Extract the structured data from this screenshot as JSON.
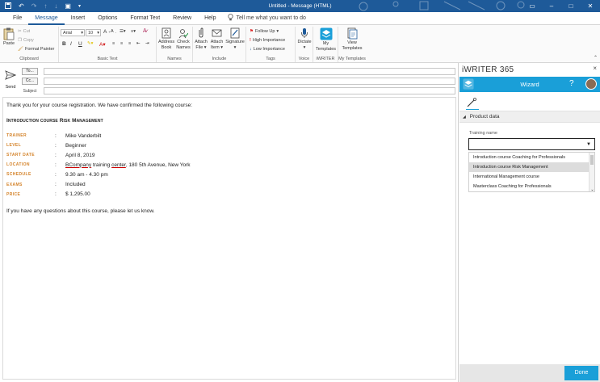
{
  "window": {
    "title": "Untitled - Message (HTML)"
  },
  "tabs": [
    "File",
    "Message",
    "Insert",
    "Options",
    "Format Text",
    "Review",
    "Help"
  ],
  "tell_me": "Tell me what you want to do",
  "ribbon": {
    "clipboard": {
      "label": "Clipboard",
      "paste": "Paste",
      "cut": "Cut",
      "copy": "Copy",
      "format_painter": "Format Painter"
    },
    "basic_text": {
      "label": "Basic Text",
      "font": "Arial",
      "size": "10",
      "bold": "B",
      "italic": "I",
      "underline": "U"
    },
    "names": {
      "label": "Names",
      "address_book": [
        "Address",
        "Book"
      ],
      "check_names": [
        "Check",
        "Names"
      ]
    },
    "include": {
      "label": "Include",
      "attach_file": [
        "Attach",
        "File"
      ],
      "attach_item": [
        "Attach",
        "Item"
      ],
      "signature": "Signature"
    },
    "tags": {
      "label": "Tags",
      "follow_up": "Follow Up",
      "high_importance": "High Importance",
      "low_importance": "Low Importance"
    },
    "voice": {
      "label": "Voice",
      "dictate": "Dictate"
    },
    "iwriter": {
      "label": "iWRITER",
      "my_templates": [
        "My",
        "Templates"
      ]
    },
    "my_templates_group": {
      "label": "My Templates",
      "view_templates": [
        "View",
        "Templates"
      ]
    }
  },
  "compose": {
    "send": "Send",
    "to": "To...",
    "cc": "Cc...",
    "subject": "Subject"
  },
  "email": {
    "intro": "Thank you for your course registration. We have confirmed the following course:",
    "course_title": "Introduction course Risk Management",
    "rows": [
      {
        "key": "TRAINER",
        "colon": ":",
        "value": "Mike Vanderbilt"
      },
      {
        "key": "LEVEL",
        "colon": ":",
        "value": "Beginner"
      },
      {
        "key": "START DATE",
        "colon": ":",
        "value": "April 8, 2019"
      },
      {
        "key": "LOCATION",
        "colon": ":",
        "value_a": "BCompany",
        "value_b": " training ",
        "value_c": "center",
        "value_d": ", 180 5th Avenue, New York"
      },
      {
        "key": "SCHEDULE",
        "colon": ":",
        "value": "9.30 am - 4.30 pm"
      },
      {
        "key": "EXAMS",
        "colon": ":",
        "value": "Included"
      },
      {
        "key": "PRICE",
        "colon": ":",
        "value": "$ 1,295.00"
      }
    ],
    "closing": "If you have any questions about this course, please let us know."
  },
  "pane": {
    "title": "iWRITER 365",
    "close": "×",
    "wizard": "Wizard",
    "help": "?",
    "section": "Product data",
    "field_label": "Training name",
    "options": [
      "Introduction course Coaching for Professionals",
      "Introduction course Risk Management",
      "International Management course",
      "Masterclass Coaching for Professionals"
    ],
    "done": "Done"
  },
  "colors": {
    "title_bar": "#1e5a99",
    "accent": "#1a9fd8",
    "label_orange": "#d4832a"
  }
}
